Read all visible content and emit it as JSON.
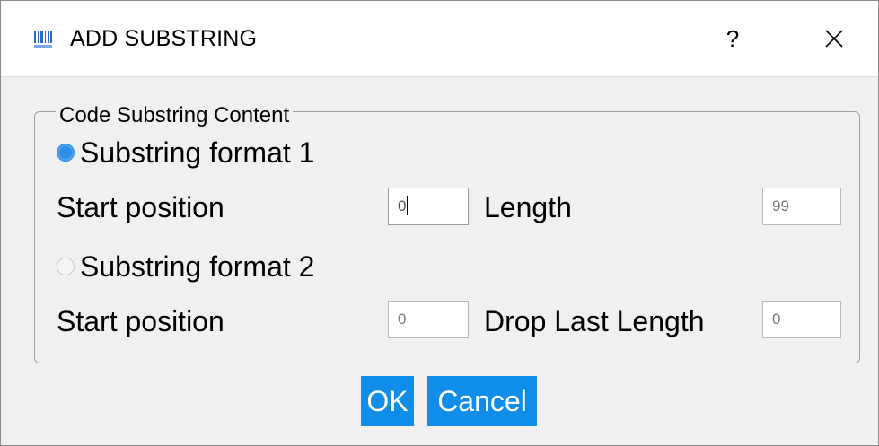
{
  "dialog": {
    "title": "ADD SUBSTRING",
    "help_label": "?",
    "close_icon": "close-icon",
    "app_icon": "barcode-icon"
  },
  "group": {
    "title": "Code Substring Content",
    "format1": {
      "label": "Substring format 1",
      "selected": true,
      "start_label": "Start position",
      "start_value": "0",
      "length_label": "Length",
      "length_value": "99"
    },
    "format2": {
      "label": "Substring format 2",
      "selected": false,
      "start_label": "Start position",
      "start_value": "0",
      "drop_label": "Drop Last Length",
      "drop_value": "0"
    }
  },
  "buttons": {
    "ok": "OK",
    "cancel": "Cancel"
  },
  "colors": {
    "accent": "#0f8de8",
    "radio_selected": "#2f8fe8"
  }
}
